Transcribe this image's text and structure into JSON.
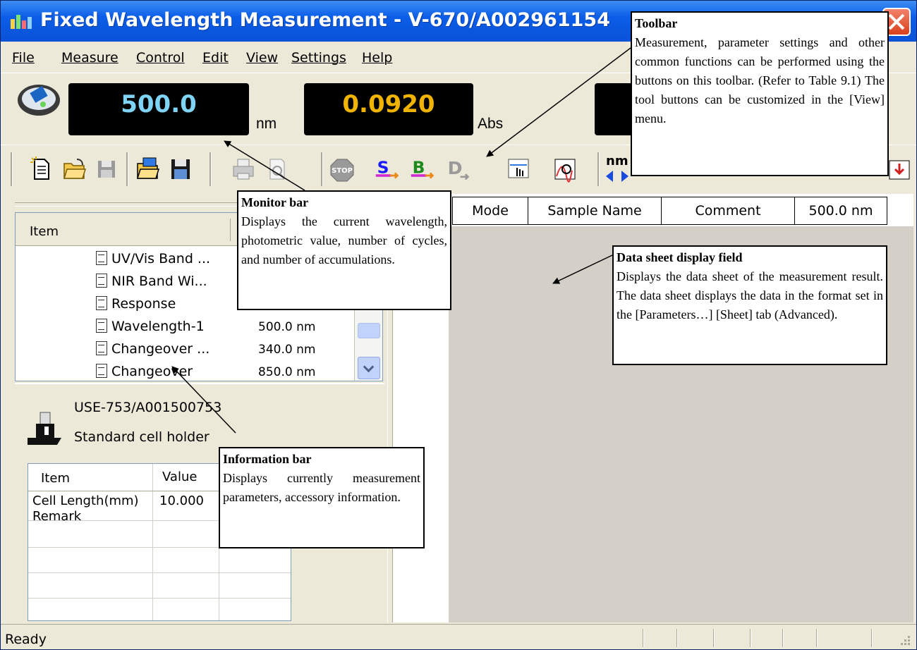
{
  "window": {
    "title": "Fixed Wavelength Measurement - V-670/A002961154"
  },
  "menu": [
    "File",
    "Measure",
    "Control",
    "Edit",
    "View",
    "Settings",
    "Help"
  ],
  "monitor": {
    "wavelength": "500.0",
    "wavelength_unit": "nm",
    "photometric": "0.0920",
    "photometric_unit": "Abs"
  },
  "toolbar": {
    "icons": [
      "new-file-icon",
      "open-folder-icon",
      "save-icon",
      "open-params-icon",
      "save-params-icon",
      "print-icon",
      "print-preview-icon",
      "stop-icon",
      "sample-measure-icon",
      "baseline-icon",
      "dark-icon",
      "manual-icon",
      "spectrum-view-icon",
      "wavelength-move-icon",
      "autozero-icon",
      "cell-change-icon",
      "lamp-icon",
      "export-icon"
    ],
    "partial_label": "nm"
  },
  "params_grid": {
    "header": "Item",
    "rows": [
      {
        "name": "UV/Vis Band ...",
        "value": ""
      },
      {
        "name": "NIR Band Wi...",
        "value": ""
      },
      {
        "name": "Response",
        "value": ""
      },
      {
        "name": "Wavelength-1",
        "value": "500.0 nm"
      },
      {
        "name": "Changeover ...",
        "value": "340.0 nm"
      },
      {
        "name": "Changeover",
        "value": "850.0 nm"
      }
    ]
  },
  "accessory": {
    "model": "USE-753/A001500753",
    "name": "Standard cell holder"
  },
  "info_grid": {
    "columns": [
      "Item",
      "Value"
    ],
    "rows": [
      {
        "item": "Cell Length(mm)",
        "value": "10.000"
      },
      {
        "item": "Remark",
        "value": ""
      }
    ]
  },
  "sheet": {
    "columns": [
      "Mode",
      "Sample Name",
      "Comment",
      "500.0 nm"
    ]
  },
  "status": {
    "text": "Ready"
  },
  "callouts": {
    "toolbar": {
      "title": "Toolbar",
      "body": "Measurement, parameter settings and other common functions can be performed using the buttons on this toolbar. (Refer to Table 9.1) The tool buttons can be customized in the [View] menu."
    },
    "monitor": {
      "title": "Monitor bar",
      "body": "Displays the current wavelength, photometric value, number of cycles, and number of accumulations."
    },
    "datasheet": {
      "title": "Data sheet display field",
      "body": "Displays the data sheet of the measurement result. The data sheet displays the data in the format set in the [Parameters…] [Sheet] tab (Advanced)."
    },
    "info": {
      "title": "Information bar",
      "body": "Displays currently measurement parameters, accessory information."
    }
  },
  "colors": {
    "titlebar": "#0b5de8",
    "wavelength_text": "#7fd3f5",
    "photometric_text": "#f0b400",
    "window_bg": "#ece9d8",
    "sheet_bg": "#d4d0c8"
  }
}
